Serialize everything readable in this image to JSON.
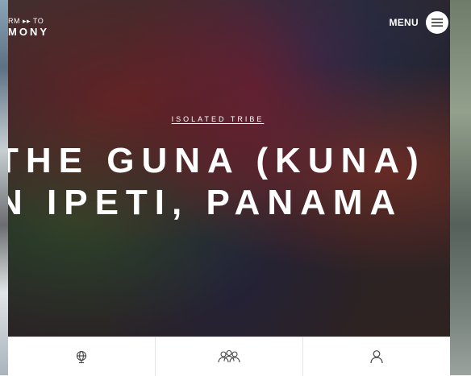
{
  "header": {
    "logo_line1": "RM ▸▸ TO",
    "logo_line2": "MONY",
    "menu_label": "MENU"
  },
  "hero": {
    "tag": "ISOLATED TRIBE",
    "headline_line1": "THE GUNA (KUNA)",
    "headline_line2": "N IPETI, PANAMA"
  },
  "bottom_nav": {
    "items": [
      {
        "icon": "globe-icon"
      },
      {
        "icon": "people-icon"
      },
      {
        "icon": "user-icon"
      }
    ]
  },
  "colors": {
    "bar_background": "#ffffff",
    "text_on_hero": "#ffffff",
    "icon_color": "#444444"
  }
}
